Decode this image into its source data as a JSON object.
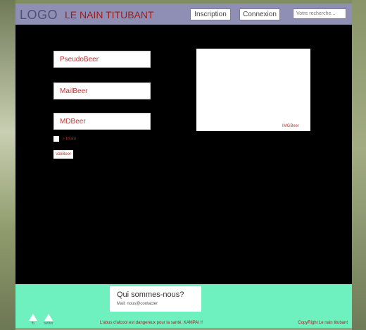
{
  "header": {
    "logo": "LOGO",
    "site_name": "LE NAIN TITUBANT",
    "register_label": "Inscription",
    "login_label": "Connexion",
    "search_placeholder": "Votre recherche..."
  },
  "form": {
    "username_placeholder": "PseudoBeer",
    "email_placeholder": "MailBeer",
    "password_placeholder": "MDBeer",
    "age_check_label": "> 18 ans",
    "submit_label": "ValiBeer"
  },
  "image": {
    "label": "IMGBeer"
  },
  "footer": {
    "about_title": "Qui sommes-nous?",
    "about_mail": "Mail: nous@contacter",
    "facebook_label": "fb",
    "twitter_label": "twitter",
    "warning_text": "L'abus d'alcool est dangereux pour la santé, KAMPAI !!",
    "copyright_text": "CopyRight Le nain titubant"
  },
  "colors": {
    "header_bg": "#8f8fb5",
    "content_bg": "#000000",
    "footer_bg": "#6ff0bf",
    "accent_text": "#9b1d1d"
  }
}
